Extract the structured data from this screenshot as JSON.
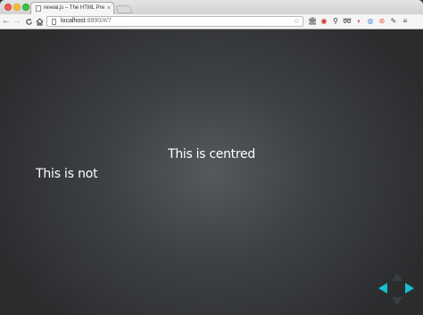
{
  "browser": {
    "tab": {
      "title": "reveal.js – The HTML Presentation Framework",
      "close_glyph": "×"
    },
    "nav": {
      "back": "←",
      "forward": "→",
      "reload": "C",
      "home": "⌂"
    },
    "address": {
      "host": "localhost",
      "rest": ":8890/#/7",
      "star": "☆"
    },
    "extensions": [
      {
        "name": "museum-icon",
        "glyph": "🏛",
        "color": "#333333"
      },
      {
        "name": "lastpass-icon",
        "glyph": "◉",
        "color": "#d0342c"
      },
      {
        "name": "magnifier-icon",
        "glyph": "⚲",
        "color": "#333333"
      },
      {
        "name": "spiral-icon",
        "glyph": "➿",
        "color": "#333333"
      },
      {
        "name": "pocket-icon",
        "glyph": "◗",
        "color": "#e8384f"
      },
      {
        "name": "compass-icon",
        "glyph": "◍",
        "color": "#5a8fd8"
      },
      {
        "name": "lifebuoy-icon",
        "glyph": "⊛",
        "color": "#e45a2a"
      },
      {
        "name": "wrench-icon",
        "glyph": "✎",
        "color": "#444444"
      },
      {
        "name": "menu-icon",
        "glyph": "≡",
        "color": "#444444"
      }
    ]
  },
  "slide": {
    "centred_text": "This is centred",
    "not_centred_text": "This is not"
  },
  "controls": {
    "accent": "#13daec"
  }
}
